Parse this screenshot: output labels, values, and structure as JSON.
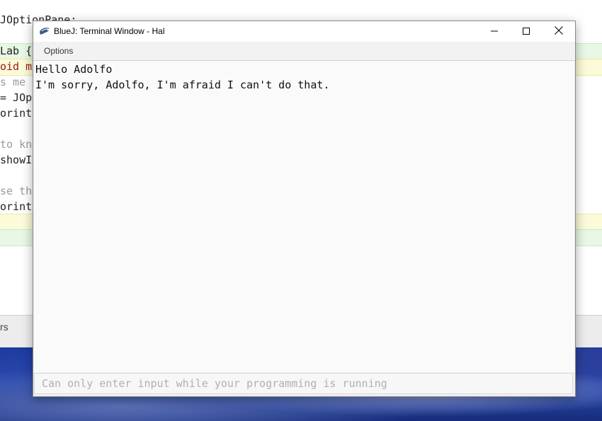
{
  "editor": {
    "lines": [
      {
        "text": "JOptionPane;",
        "cls": ""
      },
      {
        "text": "Lab {",
        "cls": ""
      },
      {
        "text": "oid ma",
        "cls": "kw"
      },
      {
        "text": "s me t",
        "cls": "gray"
      },
      {
        "text": "= JOp",
        "cls": ""
      },
      {
        "text": "orintl",
        "cls": ""
      },
      {
        "text": "",
        "cls": ""
      },
      {
        "text": "to kn",
        "cls": "gray"
      },
      {
        "text": "showI",
        "cls": ""
      },
      {
        "text": "",
        "cls": ""
      },
      {
        "text": "se th",
        "cls": "gray"
      },
      {
        "text": "orintl",
        "cls": ""
      }
    ],
    "status_text": "rs"
  },
  "window": {
    "title": "BlueJ: Terminal Window - Hal",
    "menu": {
      "options_label": "Options"
    }
  },
  "terminal": {
    "output": [
      "Hello Adolfo",
      "I'm sorry, Adolfo, I'm afraid I can't do that."
    ],
    "input_placeholder": "Can only enter input while your programming is running"
  },
  "icons": {
    "app": "bluej-icon",
    "minimize": "minimize-icon",
    "maximize": "maximize-icon",
    "close": "close-icon"
  }
}
